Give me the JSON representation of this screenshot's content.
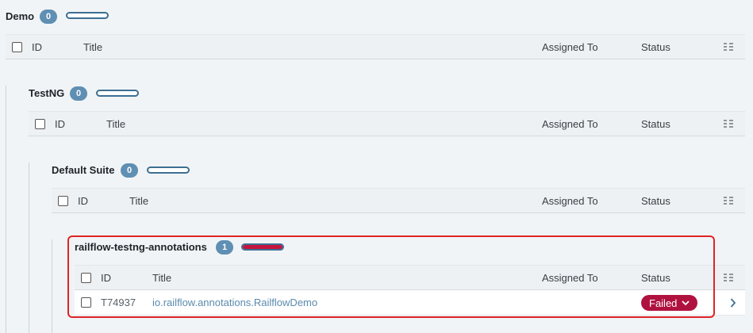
{
  "columns": {
    "id": "ID",
    "title": "Title",
    "assigned_to": "Assigned To",
    "status": "Status"
  },
  "sections": [
    {
      "name": "Demo",
      "count": "0",
      "progress_failed_fraction": 0
    },
    {
      "name": "TestNG",
      "count": "0",
      "progress_failed_fraction": 0
    },
    {
      "name": "Default Suite",
      "count": "0",
      "progress_failed_fraction": 0
    },
    {
      "name": "railflow-testng-annotations",
      "count": "1",
      "progress_failed_fraction": 1
    }
  ],
  "rows": [
    {
      "id": "T74937",
      "title": "io.railflow.annotations.RailflowDemo",
      "assigned_to": "",
      "status": "Failed"
    }
  ],
  "icons": {
    "columns": "columns-icon",
    "chevron_down": "chevron-down-icon",
    "chevron_right": "chevron-right-icon"
  },
  "colors": {
    "badge": "#5f8fb3",
    "failed": "#b0123f",
    "highlight": "#e02424",
    "link": "#5a8bad"
  }
}
